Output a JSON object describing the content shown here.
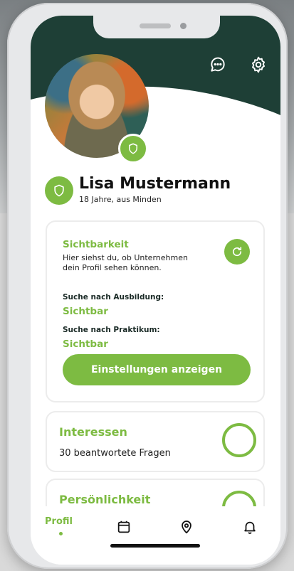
{
  "header": {
    "chat_icon": "chat-bubble-icon",
    "settings_icon": "gear-icon"
  },
  "profile": {
    "name": "Lisa Mustermann",
    "subtitle": "18 Jahre, aus Minden",
    "badge_icon": "shield-icon"
  },
  "visibility": {
    "title": "Sichtbarkeit",
    "description": "Hier siehst du, ob Unternehmen dein Profil sehen können.",
    "refresh_icon": "refresh-icon",
    "items": [
      {
        "label": "Suche nach Ausbildung:",
        "value": "Sichtbar"
      },
      {
        "label": "Suche nach Praktikum:",
        "value": "Sichtbar"
      }
    ],
    "button_label": "Einstellungen anzeigen"
  },
  "interests": {
    "title": "Interessen",
    "subtitle": "30 beantwortete Fragen"
  },
  "personality": {
    "title": "Persönlichkeit"
  },
  "tabbar": {
    "profil_label": "Profil",
    "tabs": [
      "calendar-icon",
      "location-pin-icon",
      "bell-icon"
    ]
  },
  "colors": {
    "accent": "#7dbb42",
    "header": "#1e3f36"
  }
}
